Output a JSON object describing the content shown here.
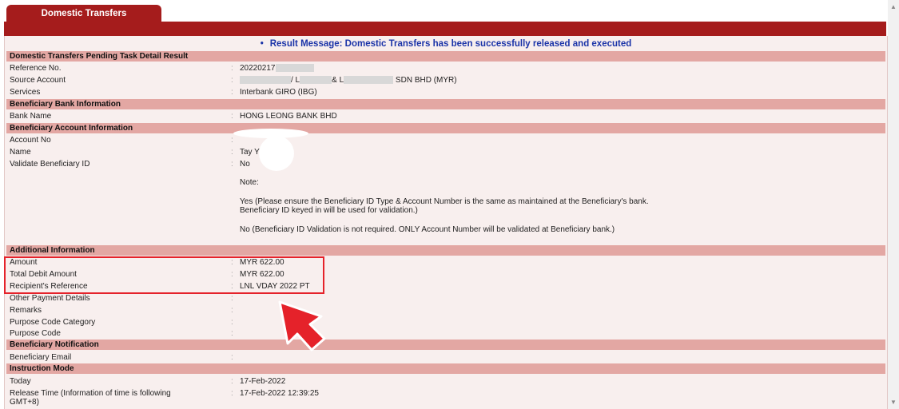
{
  "tab": {
    "label": "Domestic Transfers"
  },
  "message": {
    "text": "Result Message: Domestic Transfers has been successfully released and executed"
  },
  "sections": {
    "pending": "Domestic Transfers Pending Task Detail Result",
    "bank": "Beneficiary Bank Information",
    "account": "Beneficiary Account Information",
    "additional": "Additional Information",
    "notification": "Beneficiary Notification",
    "instruction": "Instruction Mode"
  },
  "fields": {
    "reference_no": {
      "label": "Reference No.",
      "value": "20220217"
    },
    "source_account": {
      "label": "Source Account",
      "part1": "/ L",
      "part2": "& L",
      "part3": "SDN BHD (MYR)"
    },
    "services": {
      "label": "Services",
      "value": "Interbank GIRO (IBG)"
    },
    "bank_name": {
      "label": "Bank Name",
      "value": "HONG LEONG BANK BHD"
    },
    "account_no": {
      "label": "Account No",
      "value": ""
    },
    "name": {
      "label": "Name",
      "value": "Tay Y"
    },
    "validate_id": {
      "label": "Validate Beneficiary ID",
      "value": "No"
    },
    "amount": {
      "label": "Amount",
      "value": "MYR 622.00"
    },
    "total_debit": {
      "label": "Total Debit Amount",
      "value": "MYR 622.00"
    },
    "recipient_ref": {
      "label": "Recipient's Reference",
      "value": "LNL VDAY 2022 PT"
    },
    "other_payment": {
      "label": "Other Payment Details",
      "value": ""
    },
    "remarks": {
      "label": "Remarks",
      "value": ""
    },
    "purpose_category": {
      "label": "Purpose Code Category",
      "value": ""
    },
    "purpose_code": {
      "label": "Purpose Code",
      "value": ""
    },
    "beneficiary_email": {
      "label": "Beneficiary Email",
      "value": ""
    },
    "today": {
      "label": "Today",
      "value": "17-Feb-2022"
    },
    "release_time": {
      "label_line1": "Release Time (Information of time is following",
      "label_line2": "GMT+8)",
      "value": "17-Feb-2022 12:39:25"
    }
  },
  "note": {
    "title": "Note:",
    "yes_line1": "Yes (Please ensure the Beneficiary ID Type & Account Number is the same as maintained at the Beneficiary's bank.",
    "yes_line2": "Beneficiary ID keyed in will be used for validation.)",
    "no_line": "No (Beneficiary ID Validation is not required. ONLY Account Number will be validated at Beneficiary bank.)"
  },
  "separator": ":",
  "colors": {
    "brand": "#a51c1c",
    "section": "#e3a7a3",
    "message": "#1a33a8",
    "highlight": "#e5222a"
  },
  "icons": {
    "pointer": "arrow-cursor-icon",
    "bullet": "bullet-icon"
  }
}
